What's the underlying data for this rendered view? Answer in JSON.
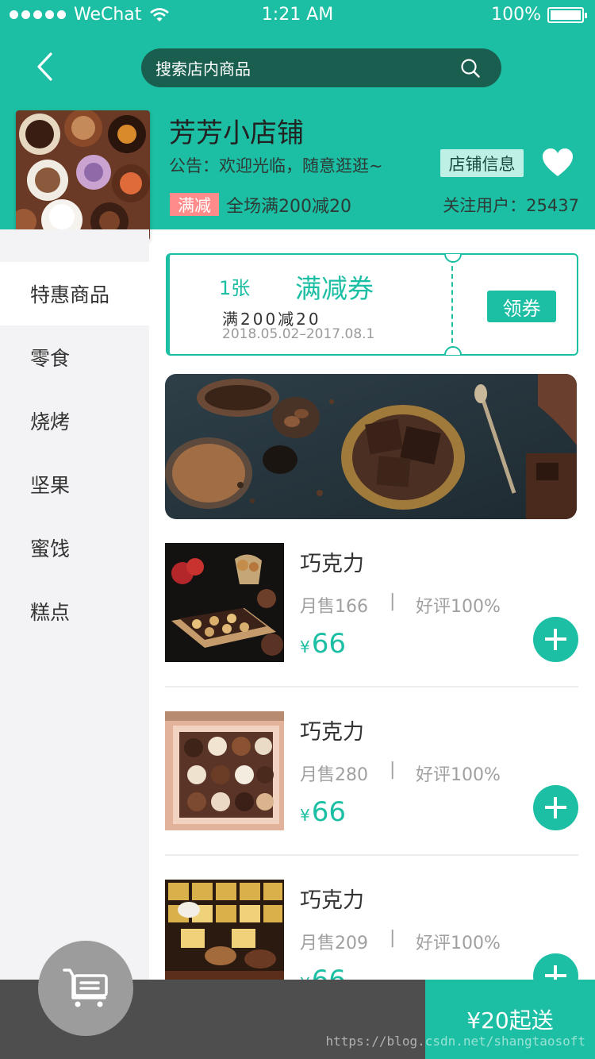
{
  "status_bar": {
    "carrier": "WeChat",
    "time": "1:21 AM",
    "battery": "100%",
    "battery_level": 1.0
  },
  "header": {
    "search_placeholder": "搜索店内商品",
    "shop_name": "芳芳小店铺",
    "notice": "公告：欢迎光临，随意逛逛~",
    "info_button": "店铺信息",
    "promo_tag": "满减",
    "promo_text": "全场满200减20",
    "followers": "关注用户：25437"
  },
  "sidebar": {
    "items": [
      {
        "label": "特惠商品",
        "active": true
      },
      {
        "label": "零食"
      },
      {
        "label": "烧烤"
      },
      {
        "label": "坚果"
      },
      {
        "label": "蜜饯"
      },
      {
        "label": "糕点"
      }
    ]
  },
  "coupon": {
    "count": "1张",
    "title": "满减券",
    "rule": "满200减20",
    "date": "2018.05.02–2017.08.1",
    "button": "领券"
  },
  "products": [
    {
      "name": "巧克力",
      "sales": "月售166",
      "sep": "|",
      "rating": "好评100%",
      "currency": "¥",
      "price": "66"
    },
    {
      "name": "巧克力",
      "sales": "月售280",
      "sep": "|",
      "rating": "好评100%",
      "currency": "¥",
      "price": "66"
    },
    {
      "name": "巧克力",
      "sales": "月售209",
      "sep": "|",
      "rating": "好评100%",
      "currency": "¥",
      "price": "66"
    }
  ],
  "bottom_bar": {
    "checkout": "¥20起送",
    "watermark": "https://blog.csdn.net/shangtaosoft"
  },
  "colors": {
    "brand": "#1cbfa3",
    "search_bg": "#1a5e50",
    "promo_tag": "#ff8b8b",
    "bottom_bar": "#4e4e4e"
  },
  "icons": [
    "back-chevron-icon",
    "search-icon",
    "heart-icon",
    "plus-icon",
    "cart-icon",
    "wifi-icon"
  ]
}
